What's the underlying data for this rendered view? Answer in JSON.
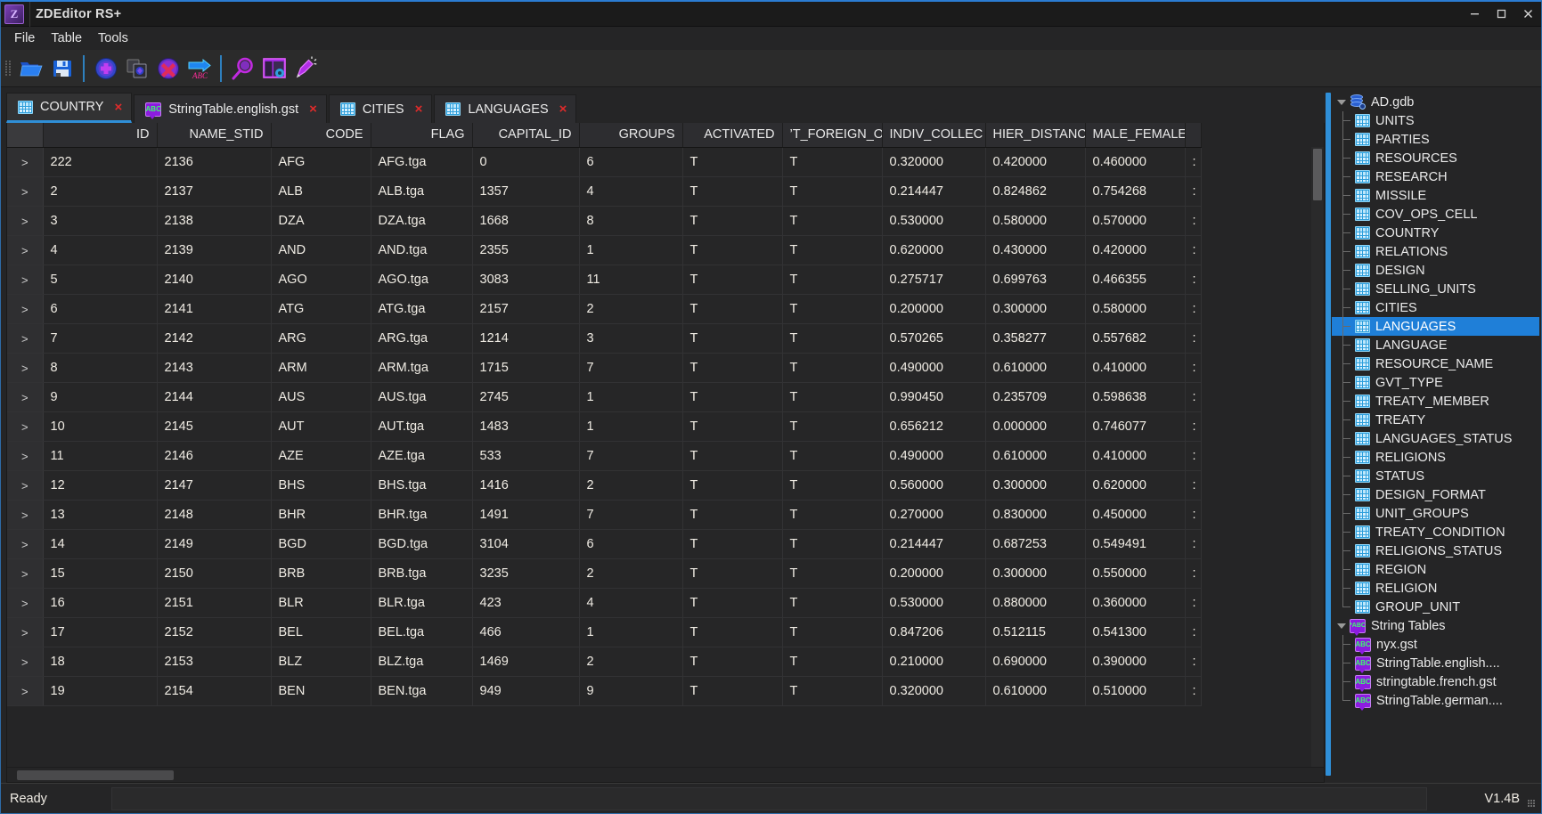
{
  "window": {
    "title": "ZDEditor RS+",
    "app_icon": "Z",
    "minimize_label": "Minimize",
    "maximize_label": "Maximize",
    "close_label": "Close"
  },
  "menubar": {
    "items": [
      {
        "label": "File",
        "name": "menu-file"
      },
      {
        "label": "Table",
        "name": "menu-table"
      },
      {
        "label": "Tools",
        "name": "menu-tools"
      }
    ]
  },
  "toolbar": {
    "buttons": [
      {
        "name": "open-folder-icon",
        "title": "Open"
      },
      {
        "name": "save-icon",
        "title": "Save"
      },
      {
        "name": "add-record-icon",
        "title": "Add"
      },
      {
        "name": "duplicate-record-icon",
        "title": "Duplicate"
      },
      {
        "name": "delete-record-icon",
        "title": "Delete"
      },
      {
        "name": "export-abc-icon",
        "title": "Export Strings"
      },
      {
        "name": "search-icon",
        "title": "Search"
      },
      {
        "name": "layout-settings-icon",
        "title": "Layout Settings"
      },
      {
        "name": "highlighter-icon",
        "title": "Highlight"
      }
    ]
  },
  "tabs": [
    {
      "label": "COUNTRY",
      "icon": "table-icon",
      "active": true,
      "close": "×"
    },
    {
      "label": "StringTable.english.gst",
      "icon": "string-table-icon",
      "active": false,
      "close": "×"
    },
    {
      "label": "CITIES",
      "icon": "table-icon",
      "active": false,
      "close": "×"
    },
    {
      "label": "LANGUAGES",
      "icon": "table-icon",
      "active": false,
      "close": "×"
    }
  ],
  "grid": {
    "columns": [
      {
        "key": "rowhdr",
        "label": "",
        "cls": "c-rowhdr"
      },
      {
        "key": "id",
        "label": "ID",
        "cls": "c-id"
      },
      {
        "key": "name_stid",
        "label": "NAME_STID",
        "cls": "c-namestid"
      },
      {
        "key": "code",
        "label": "CODE",
        "cls": "c-code"
      },
      {
        "key": "flag",
        "label": "FLAG",
        "cls": "c-flag"
      },
      {
        "key": "capital_id",
        "label": "CAPITAL_ID",
        "cls": "c-capital"
      },
      {
        "key": "groups",
        "label": "GROUPS",
        "cls": "c-groups"
      },
      {
        "key": "activated",
        "label": "ACTIVATED",
        "cls": "c-activated"
      },
      {
        "key": "foreign",
        "label": "’T_FOREIGN_O",
        "cls": "c-foreign"
      },
      {
        "key": "indiv_collec",
        "label": "INDIV_COLLEC",
        "cls": "c-indiv"
      },
      {
        "key": "hier_distance",
        "label": "ΗIER_DISTANCE",
        "cls": "c-hier"
      },
      {
        "key": "male_female",
        "label": "MALE_FEMALE",
        "cls": "c-male"
      },
      {
        "key": "overflow",
        "label": "",
        "cls": "c-last"
      }
    ],
    "row_marker": ">",
    "rows": [
      {
        "id": "222",
        "name_stid": "2136",
        "code": "AFG",
        "flag": "AFG.tga",
        "capital_id": "0",
        "groups": "6",
        "activated": "T",
        "foreign": "T",
        "indiv_collec": "0.320000",
        "hier_distance": "0.420000",
        "male_female": "0.460000",
        "overflow": ":"
      },
      {
        "id": "2",
        "name_stid": "2137",
        "code": "ALB",
        "flag": "ALB.tga",
        "capital_id": "1357",
        "groups": "4",
        "activated": "T",
        "foreign": "T",
        "indiv_collec": "0.214447",
        "hier_distance": "0.824862",
        "male_female": "0.754268",
        "overflow": ":"
      },
      {
        "id": "3",
        "name_stid": "2138",
        "code": "DZA",
        "flag": "DZA.tga",
        "capital_id": "1668",
        "groups": "8",
        "activated": "T",
        "foreign": "T",
        "indiv_collec": "0.530000",
        "hier_distance": "0.580000",
        "male_female": "0.570000",
        "overflow": ":"
      },
      {
        "id": "4",
        "name_stid": "2139",
        "code": "AND",
        "flag": "AND.tga",
        "capital_id": "2355",
        "groups": "1",
        "activated": "T",
        "foreign": "T",
        "indiv_collec": "0.620000",
        "hier_distance": "0.430000",
        "male_female": "0.420000",
        "overflow": ":"
      },
      {
        "id": "5",
        "name_stid": "2140",
        "code": "AGO",
        "flag": "AGO.tga",
        "capital_id": "3083",
        "groups": "11",
        "activated": "T",
        "foreign": "T",
        "indiv_collec": "0.275717",
        "hier_distance": "0.699763",
        "male_female": "0.466355",
        "overflow": ":"
      },
      {
        "id": "6",
        "name_stid": "2141",
        "code": "ATG",
        "flag": "ATG.tga",
        "capital_id": "2157",
        "groups": "2",
        "activated": "T",
        "foreign": "T",
        "indiv_collec": "0.200000",
        "hier_distance": "0.300000",
        "male_female": "0.580000",
        "overflow": ":"
      },
      {
        "id": "7",
        "name_stid": "2142",
        "code": "ARG",
        "flag": "ARG.tga",
        "capital_id": "1214",
        "groups": "3",
        "activated": "T",
        "foreign": "T",
        "indiv_collec": "0.570265",
        "hier_distance": "0.358277",
        "male_female": "0.557682",
        "overflow": ":"
      },
      {
        "id": "8",
        "name_stid": "2143",
        "code": "ARM",
        "flag": "ARM.tga",
        "capital_id": "1715",
        "groups": "7",
        "activated": "T",
        "foreign": "T",
        "indiv_collec": "0.490000",
        "hier_distance": "0.610000",
        "male_female": "0.410000",
        "overflow": ":"
      },
      {
        "id": "9",
        "name_stid": "2144",
        "code": "AUS",
        "flag": "AUS.tga",
        "capital_id": "2745",
        "groups": "1",
        "activated": "T",
        "foreign": "T",
        "indiv_collec": "0.990450",
        "hier_distance": "0.235709",
        "male_female": "0.598638",
        "overflow": ":"
      },
      {
        "id": "10",
        "name_stid": "2145",
        "code": "AUT",
        "flag": "AUT.tga",
        "capital_id": "1483",
        "groups": "1",
        "activated": "T",
        "foreign": "T",
        "indiv_collec": "0.656212",
        "hier_distance": "0.000000",
        "male_female": "0.746077",
        "overflow": ":"
      },
      {
        "id": "11",
        "name_stid": "2146",
        "code": "AZE",
        "flag": "AZE.tga",
        "capital_id": "533",
        "groups": "7",
        "activated": "T",
        "foreign": "T",
        "indiv_collec": "0.490000",
        "hier_distance": "0.610000",
        "male_female": "0.410000",
        "overflow": ":"
      },
      {
        "id": "12",
        "name_stid": "2147",
        "code": "BHS",
        "flag": "BHS.tga",
        "capital_id": "1416",
        "groups": "2",
        "activated": "T",
        "foreign": "T",
        "indiv_collec": "0.560000",
        "hier_distance": "0.300000",
        "male_female": "0.620000",
        "overflow": ":"
      },
      {
        "id": "13",
        "name_stid": "2148",
        "code": "BHR",
        "flag": "BHR.tga",
        "capital_id": "1491",
        "groups": "7",
        "activated": "T",
        "foreign": "T",
        "indiv_collec": "0.270000",
        "hier_distance": "0.830000",
        "male_female": "0.450000",
        "overflow": ":"
      },
      {
        "id": "14",
        "name_stid": "2149",
        "code": "BGD",
        "flag": "BGD.tga",
        "capital_id": "3104",
        "groups": "6",
        "activated": "T",
        "foreign": "T",
        "indiv_collec": "0.214447",
        "hier_distance": "0.687253",
        "male_female": "0.549491",
        "overflow": ":"
      },
      {
        "id": "15",
        "name_stid": "2150",
        "code": "BRB",
        "flag": "BRB.tga",
        "capital_id": "3235",
        "groups": "2",
        "activated": "T",
        "foreign": "T",
        "indiv_collec": "0.200000",
        "hier_distance": "0.300000",
        "male_female": "0.550000",
        "overflow": ":"
      },
      {
        "id": "16",
        "name_stid": "2151",
        "code": "BLR",
        "flag": "BLR.tga",
        "capital_id": "423",
        "groups": "4",
        "activated": "T",
        "foreign": "T",
        "indiv_collec": "0.530000",
        "hier_distance": "0.880000",
        "male_female": "0.360000",
        "overflow": ":"
      },
      {
        "id": "17",
        "name_stid": "2152",
        "code": "BEL",
        "flag": "BEL.tga",
        "capital_id": "466",
        "groups": "1",
        "activated": "T",
        "foreign": "T",
        "indiv_collec": "0.847206",
        "hier_distance": "0.512115",
        "male_female": "0.541300",
        "overflow": ":"
      },
      {
        "id": "18",
        "name_stid": "2153",
        "code": "BLZ",
        "flag": "BLZ.tga",
        "capital_id": "1469",
        "groups": "2",
        "activated": "T",
        "foreign": "T",
        "indiv_collec": "0.210000",
        "hier_distance": "0.690000",
        "male_female": "0.390000",
        "overflow": ":"
      },
      {
        "id": "19",
        "name_stid": "2154",
        "code": "BEN",
        "flag": "BEN.tga",
        "capital_id": "949",
        "groups": "9",
        "activated": "T",
        "foreign": "T",
        "indiv_collec": "0.320000",
        "hier_distance": "0.610000",
        "male_female": "0.510000",
        "overflow": ":"
      }
    ]
  },
  "tree": {
    "root": {
      "label": "AD.gdb",
      "icon": "database-icon",
      "expanded": true
    },
    "tables": [
      {
        "label": "UNITS"
      },
      {
        "label": "PARTIES"
      },
      {
        "label": "RESOURCES"
      },
      {
        "label": "RESEARCH"
      },
      {
        "label": "MISSILE"
      },
      {
        "label": "COV_OPS_CELL"
      },
      {
        "label": "COUNTRY"
      },
      {
        "label": "RELATIONS"
      },
      {
        "label": "DESIGN"
      },
      {
        "label": "SELLING_UNITS"
      },
      {
        "label": "CITIES"
      },
      {
        "label": "LANGUAGES",
        "selected": true
      },
      {
        "label": "LANGUAGE"
      },
      {
        "label": "RESOURCE_NAME"
      },
      {
        "label": "GVT_TYPE"
      },
      {
        "label": "TREATY_MEMBER"
      },
      {
        "label": "TREATY"
      },
      {
        "label": "LANGUAGES_STATUS"
      },
      {
        "label": "RELIGIONS"
      },
      {
        "label": "STATUS"
      },
      {
        "label": "DESIGN_FORMAT"
      },
      {
        "label": "UNIT_GROUPS"
      },
      {
        "label": "TREATY_CONDITION"
      },
      {
        "label": "RELIGIONS_STATUS"
      },
      {
        "label": "REGION"
      },
      {
        "label": "RELIGION"
      },
      {
        "label": "GROUP_UNIT"
      }
    ],
    "string_tables_group": {
      "label": "String Tables",
      "icon": "string-table-group-icon",
      "expanded": true
    },
    "string_tables": [
      {
        "label": "nyx.gst"
      },
      {
        "label": "StringTable.english...."
      },
      {
        "label": "stringtable.french.gst"
      },
      {
        "label": "StringTable.german...."
      }
    ]
  },
  "statusbar": {
    "message": "Ready",
    "detail": "",
    "version": "V1.4B"
  }
}
